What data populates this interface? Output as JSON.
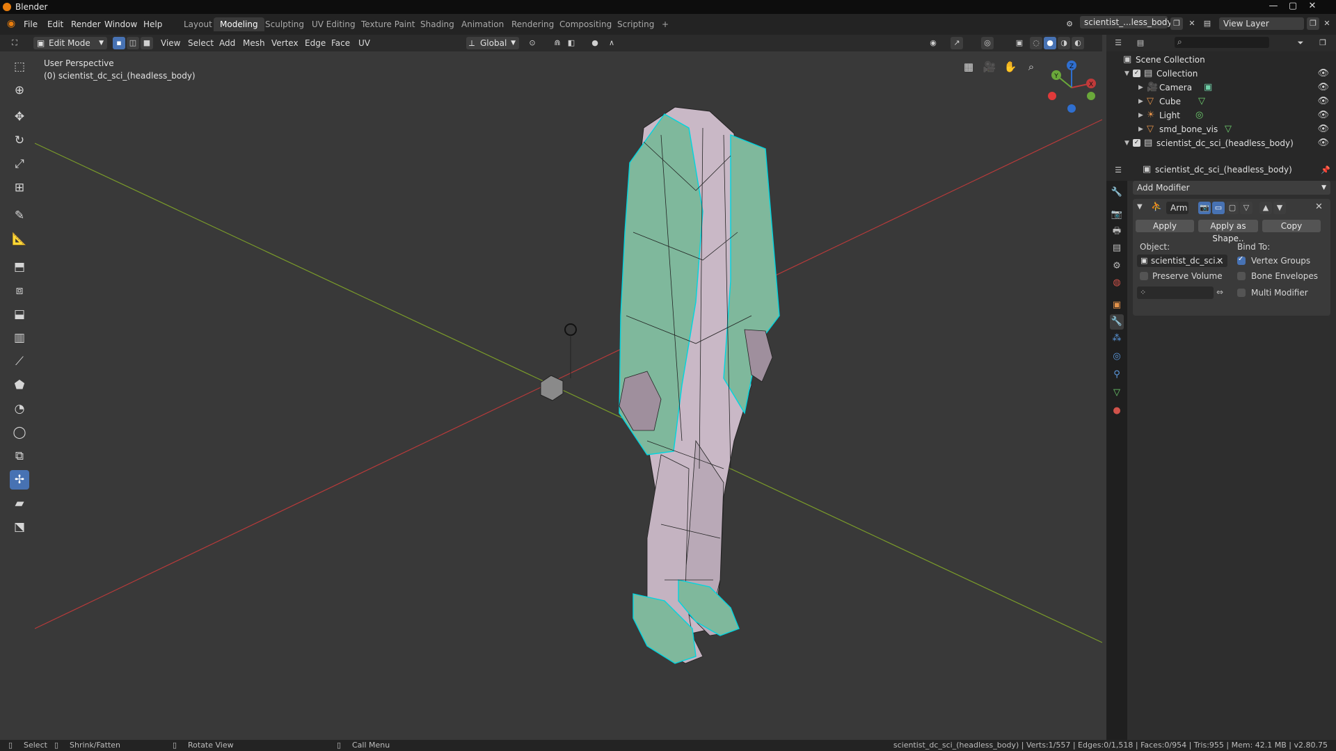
{
  "window": {
    "title": "Blender"
  },
  "menu": [
    "File",
    "Edit",
    "Render",
    "Window",
    "Help"
  ],
  "workspaces": [
    "Layout",
    "Modeling",
    "Sculpting",
    "UV Editing",
    "Texture Paint",
    "Shading",
    "Animation",
    "Rendering",
    "Compositing",
    "Scripting",
    "+"
  ],
  "active_workspace": "Modeling",
  "scene_field": "scientist_...less_body)",
  "view_layer": "View Layer",
  "header": {
    "mode": "Edit Mode",
    "menus": [
      "View",
      "Select",
      "Add",
      "Mesh",
      "Vertex",
      "Edge",
      "Face",
      "UV"
    ],
    "transform_orientation": "Global"
  },
  "viewport": {
    "perspective_label": "User Perspective",
    "object_label": "(0) scientist_dc_sci_(headless_body)",
    "gizmo_axes": {
      "x": "X",
      "y": "Y",
      "z": "Z"
    }
  },
  "outliner": {
    "search_placeholder": "",
    "items": [
      {
        "name": "Scene Collection",
        "level": 0
      },
      {
        "name": "Collection",
        "level": 1
      },
      {
        "name": "Camera",
        "level": 2
      },
      {
        "name": "Cube",
        "level": 2
      },
      {
        "name": "Light",
        "level": 2
      },
      {
        "name": "smd_bone_vis",
        "level": 2
      },
      {
        "name": "scientist_dc_sci_(headless_body)",
        "level": 1
      }
    ]
  },
  "properties": {
    "object_name": "scientist_dc_sci_(headless_body)",
    "add_modifier": "Add Modifier",
    "modifier_name": "Arm",
    "apply": "Apply",
    "apply_as_shape": "Apply as Shape..",
    "copy": "Copy",
    "object_label": "Object:",
    "object_value": "scientist_dc_sci...",
    "bind_to_label": "Bind To:",
    "preserve_volume": "Preserve Volume",
    "vertex_groups": "Vertex Groups",
    "bone_envelopes": "Bone Envelopes",
    "multi_modifier": "Multi Modifier",
    "vertex_groups_on": true,
    "preserve_volume_on": false,
    "bone_envelopes_on": false,
    "multi_modifier_on": false
  },
  "statusbar": {
    "select": "Select",
    "shrink": "Shrink/Fatten",
    "rotate": "Rotate View",
    "call_menu": "Call Menu",
    "info": "scientist_dc_sci_(headless_body) | Verts:1/557 | Edges:0/1,518 | Faces:0/954 | Tris:955 | Mem: 42.1 MB | v2.80.75"
  },
  "colors": {
    "accent": "#4772b3",
    "selection_edge": "#00d5e0",
    "body_mesh": "#c9b8c6",
    "coat_mesh": "#7fb89c",
    "axis_x": "#b73a3a",
    "axis_y": "#7a9b2a"
  }
}
